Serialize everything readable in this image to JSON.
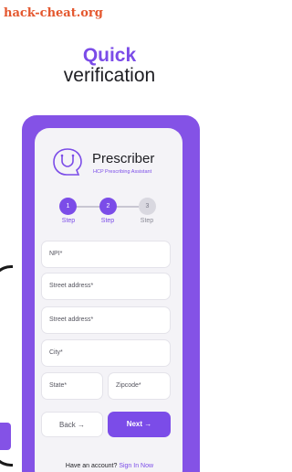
{
  "watermark": "hack-cheat.org",
  "headline": {
    "line1": "Quick",
    "line2": "verification"
  },
  "brand": {
    "name": "Prescriber",
    "subtitle": "HCP Prescribing Assistant"
  },
  "steps": [
    {
      "number": "1",
      "label": "Step",
      "state": "active"
    },
    {
      "number": "2",
      "label": "Step",
      "state": "active"
    },
    {
      "number": "3",
      "label": "Step",
      "state": "idle"
    }
  ],
  "form": {
    "npi_placeholder": "NPI*",
    "street1_placeholder": "Street address*",
    "street2_placeholder": "Street address*",
    "city_placeholder": "City*",
    "state_placeholder": "State*",
    "zip_placeholder": "Zipcode*"
  },
  "buttons": {
    "back": "Back",
    "next": "Next",
    "arrow": "→"
  },
  "footer": {
    "prompt": "Have an account?",
    "link": "Sign In Now"
  },
  "colors": {
    "accent": "#7b4ce8",
    "panel": "#8452e6",
    "card": "#f4f3f7",
    "watermark": "#e4572e"
  }
}
